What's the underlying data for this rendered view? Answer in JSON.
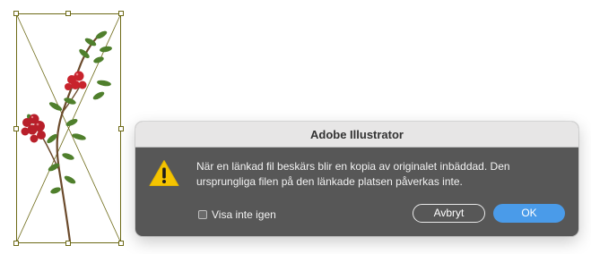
{
  "artboard": {
    "selection_color": "#6d6a17",
    "image": "lingonberry-branch"
  },
  "dialog": {
    "title": "Adobe Illustrator",
    "icon": "warning-icon",
    "message": "När en länkad fil beskärs blir en kopia av originalet inbäddad. Den ursprungliga filen på den länkade platsen påverkas inte.",
    "checkbox_label": "Visa inte igen",
    "checkbox_checked": false,
    "cancel_label": "Avbryt",
    "ok_label": "OK",
    "ok_color": "#4a9be9"
  }
}
